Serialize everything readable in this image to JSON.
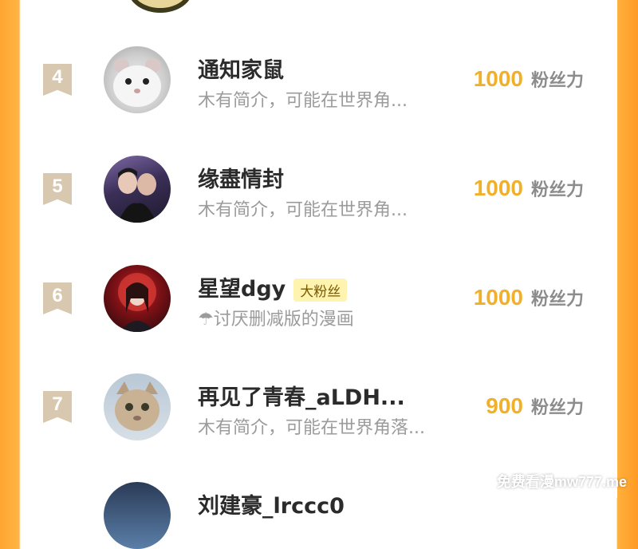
{
  "rows": [
    {
      "rank": "4",
      "name": "通知家鼠",
      "badge": "",
      "desc": "木有简介，可能在世界角...",
      "fans_count": "1000",
      "fans_unit": "粉丝力",
      "avatar_icon": "hamster-avatar"
    },
    {
      "rank": "5",
      "name": "缘盡情封",
      "badge": "",
      "desc": "木有简介，可能在世界角...",
      "fans_count": "1000",
      "fans_unit": "粉丝力",
      "avatar_icon": "couple-avatar"
    },
    {
      "rank": "6",
      "name": "星望dgy",
      "badge": "大粉丝",
      "desc": "☂讨厌删减版的漫画",
      "fans_count": "1000",
      "fans_unit": "粉丝力",
      "avatar_icon": "red-moon-avatar"
    },
    {
      "rank": "7",
      "name": "再见了青春_aLDH...",
      "badge": "",
      "desc": "木有简介，可能在世界角落...",
      "fans_count": "900",
      "fans_unit": "粉丝力",
      "avatar_icon": "cat-avatar"
    },
    {
      "rank": "",
      "name": "刘建豪_lrccc0",
      "badge": "",
      "desc": "",
      "fans_count": "",
      "fans_unit": "",
      "avatar_icon": "person-avatar"
    }
  ],
  "watermark": "免费看漫mw777.me",
  "colors": {
    "accent_orange": "#ffa531",
    "fans_gold": "#f0b02a",
    "rank_tag": "#d9c8b0"
  }
}
